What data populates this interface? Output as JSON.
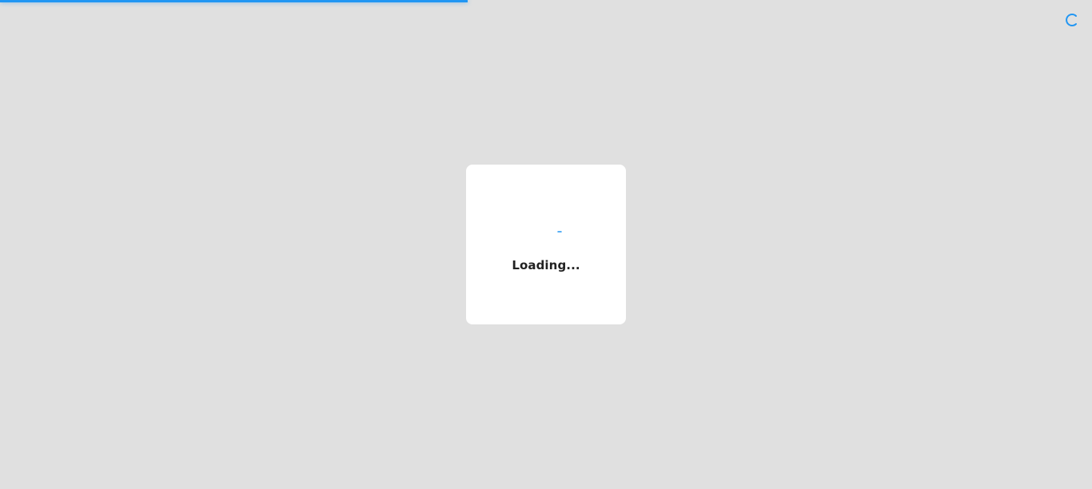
{
  "top_progress": {
    "fraction": 0.428,
    "color": "#2196f3"
  },
  "corner_spinner": {
    "icon": "spinner-icon",
    "color": "#2196f3"
  },
  "loading_card": {
    "spinner_icon": "spinner-icon",
    "spinner_color": "#2196f3",
    "text": "Loading..."
  }
}
